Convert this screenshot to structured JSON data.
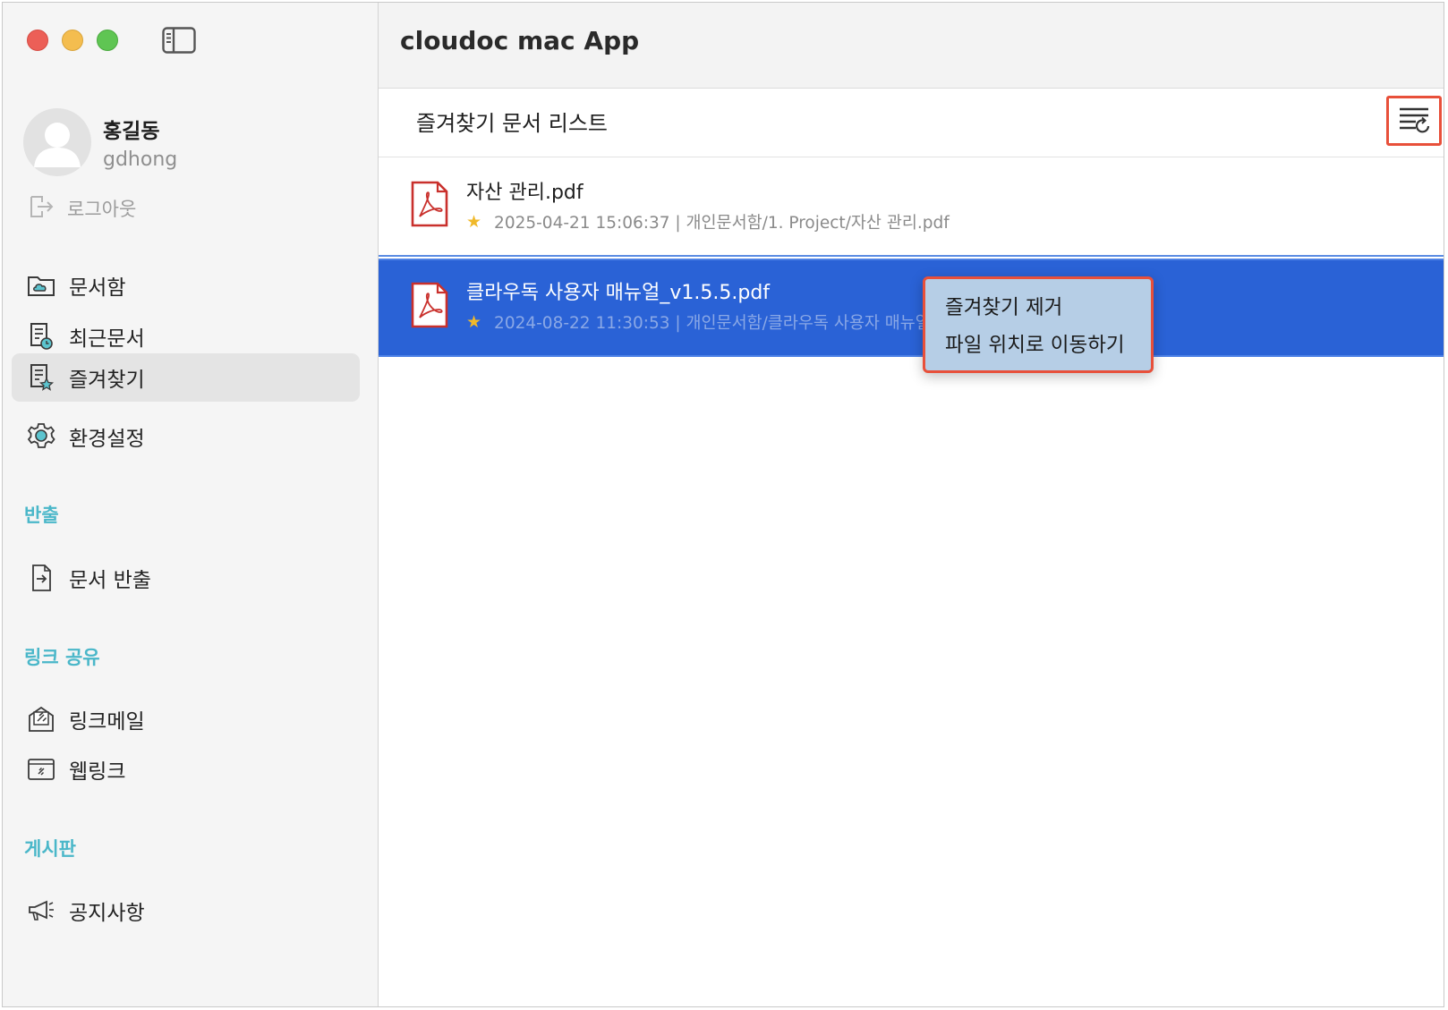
{
  "window": {
    "title": "cloudoc mac App"
  },
  "user": {
    "name": "홍길동",
    "id": "gdhong",
    "logout_label": "로그아웃"
  },
  "nav": {
    "items": [
      {
        "label": "문서함",
        "icon": "cloud-folder-icon"
      },
      {
        "label": "최근문서",
        "icon": "recent-document-icon"
      },
      {
        "label": "즐겨찾기",
        "icon": "favorite-document-icon",
        "active": true
      },
      {
        "label": "환경설정",
        "icon": "gear-icon"
      }
    ]
  },
  "sections": [
    {
      "title": "반출",
      "items": [
        {
          "label": "문서 반출",
          "icon": "document-export-icon"
        }
      ]
    },
    {
      "title": "링크 공유",
      "items": [
        {
          "label": "링크메일",
          "icon": "link-mail-icon"
        },
        {
          "label": "웹링크",
          "icon": "web-link-icon"
        }
      ]
    },
    {
      "title": "게시판",
      "items": [
        {
          "label": "공지사항",
          "icon": "megaphone-icon"
        }
      ]
    }
  ],
  "list": {
    "title": "즐겨찾기 문서 리스트",
    "filter_icon": "list-filter-icon",
    "files": [
      {
        "name": "자산 관리.pdf",
        "meta": "2025-04-21 15:06:37 | 개인문서함/1. Project/자산 관리.pdf",
        "icon": "pdf-file-icon"
      },
      {
        "name": "클라우독 사용자 매뉴얼_v1.5.5.pdf",
        "meta": "2024-08-22 11:30:53 | 개인문서함/클라우독 사용자 매뉴얼",
        "icon": "pdf-file-icon",
        "selected": true
      }
    ]
  },
  "context_menu": {
    "items": [
      "즐겨찾기 제거",
      "파일 위치로 이동하기"
    ]
  },
  "colors": {
    "accent": "#4ab7c9",
    "selection": "#2a62d6",
    "highlight": "#e8503a",
    "pdf": "#c9302c"
  }
}
